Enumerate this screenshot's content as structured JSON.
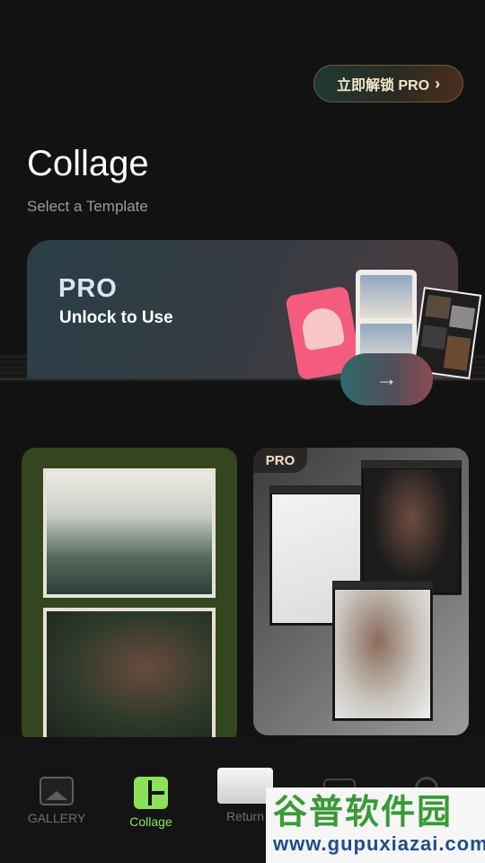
{
  "header": {
    "pro_button_label": "立即解锁 PRO",
    "title": "Collage",
    "subtitle": "Select a Template"
  },
  "banner": {
    "pro_logo": "PRO",
    "unlock_text": "Unlock to Use",
    "arrow_glyph": "→"
  },
  "templates": [
    {
      "name": "forest-green",
      "pro": false
    },
    {
      "name": "desktop-windows",
      "pro": true,
      "badge": "PRO"
    }
  ],
  "nav": {
    "items": [
      {
        "label": "GALLERY",
        "icon": "image-icon",
        "active": false
      },
      {
        "label": "Collage",
        "icon": "collage-icon",
        "active": true
      },
      {
        "label": "Return",
        "icon": "camera-icon",
        "active": false
      }
    ]
  },
  "watermark": {
    "chinese": "谷普软件园",
    "url": "www.gupuxiazai.com"
  },
  "colors": {
    "accent": "#8de15a",
    "background": "#121212",
    "pro_gold": "#f3e6c8"
  }
}
